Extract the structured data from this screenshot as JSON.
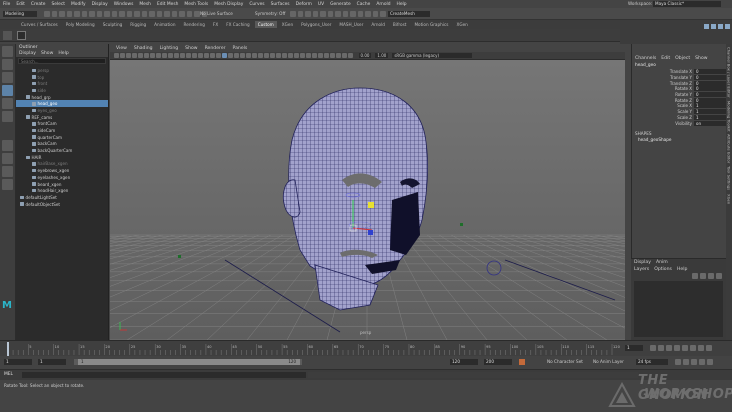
{
  "menubar": {
    "items": [
      "File",
      "Edit",
      "Create",
      "Select",
      "Modify",
      "Display",
      "Windows",
      "Mesh",
      "Edit Mesh",
      "Mesh Tools",
      "Mesh Display",
      "Curves",
      "Surfaces",
      "Deform",
      "UV",
      "Generate",
      "Cache",
      "Arnold",
      "Help"
    ],
    "workspace_label": "Workspace:",
    "workspace_value": "Maya Classic*"
  },
  "statusline": {
    "mode": "Modeling",
    "live_surface": "No Live Surface",
    "symmetry": "Symmetry: Off",
    "workspace_field": "CreateMesh"
  },
  "shelf": {
    "tabs": [
      "Curves / Surfaces",
      "Poly Modeling",
      "Sculpting",
      "Rigging",
      "Animation",
      "Rendering",
      "FX",
      "FX Caching",
      "Custom",
      "XGen",
      "Polygons_User",
      "MASH_User",
      "Arnold",
      "Bifrost",
      "Motion Graphics",
      "XGen"
    ],
    "active_tab": 8
  },
  "outliner": {
    "title": "Outliner",
    "menu": [
      "Display",
      "Show",
      "Help"
    ],
    "search_placeholder": "Search...",
    "items": [
      {
        "label": "persp",
        "indent": 2,
        "dim": true
      },
      {
        "label": "top",
        "indent": 2,
        "dim": true
      },
      {
        "label": "front",
        "indent": 2,
        "dim": true
      },
      {
        "label": "side",
        "indent": 2,
        "dim": true
      },
      {
        "label": "head_grp",
        "indent": 1,
        "dim": false
      },
      {
        "label": "head_geo",
        "indent": 2,
        "dim": false,
        "selected": true
      },
      {
        "label": "eyes_geo",
        "indent": 2,
        "dim": true
      },
      {
        "label": "REF_cams",
        "indent": 1,
        "dim": false
      },
      {
        "label": "frontCam",
        "indent": 2,
        "dim": false
      },
      {
        "label": "sideCam",
        "indent": 2,
        "dim": false
      },
      {
        "label": "quarterCam",
        "indent": 2,
        "dim": false
      },
      {
        "label": "backCam",
        "indent": 2,
        "dim": false
      },
      {
        "label": "backQuarterCam",
        "indent": 2,
        "dim": false
      },
      {
        "label": "HAIR",
        "indent": 1,
        "dim": false
      },
      {
        "label": "hairBase_xgen",
        "indent": 2,
        "dim": true
      },
      {
        "label": "eyebrows_xgen",
        "indent": 2,
        "dim": false
      },
      {
        "label": "eyelashes_xgen",
        "indent": 2,
        "dim": false
      },
      {
        "label": "beard_xgen",
        "indent": 2,
        "dim": false
      },
      {
        "label": "headHair_xgen",
        "indent": 2,
        "dim": false
      },
      {
        "label": "defaultLightSet",
        "indent": 0,
        "dim": false
      },
      {
        "label": "defaultObjectSet",
        "indent": 0,
        "dim": false
      }
    ]
  },
  "viewport": {
    "menu": [
      "View",
      "Shading",
      "Lighting",
      "Show",
      "Renderer",
      "Panels"
    ],
    "field_a": "0.00",
    "field_b": "1.00",
    "color_space": "sRGB gamma (legacy)",
    "camera_label": "persp"
  },
  "channelbox": {
    "tabs": [
      "Channels",
      "Edit",
      "Object",
      "Show"
    ],
    "object_name": "head_geo",
    "channels": [
      {
        "label": "Translate X",
        "value": "0"
      },
      {
        "label": "Translate Y",
        "value": "0"
      },
      {
        "label": "Translate Z",
        "value": "0"
      },
      {
        "label": "Rotate X",
        "value": "0"
      },
      {
        "label": "Rotate Y",
        "value": "0"
      },
      {
        "label": "Rotate Z",
        "value": "0"
      },
      {
        "label": "Scale X",
        "value": "1"
      },
      {
        "label": "Scale Y",
        "value": "1"
      },
      {
        "label": "Scale Z",
        "value": "1"
      },
      {
        "label": "Visibility",
        "value": "on"
      }
    ],
    "shapes_title": "SHAPES",
    "shape_name": "head_geoShape"
  },
  "side_tabs": [
    "Channel Box / Layer Editor",
    "Modeling Toolkit",
    "Attribute Editor",
    "Tool Settings",
    "XGen"
  ],
  "layer_editor": {
    "tabs": [
      "Display",
      "Anim"
    ],
    "menu": [
      "Layers",
      "Options",
      "Help"
    ]
  },
  "timeline": {
    "ticks": [
      "5",
      "10",
      "15",
      "20",
      "25",
      "30",
      "35",
      "40",
      "45",
      "50",
      "55",
      "60",
      "65",
      "70",
      "75",
      "80",
      "85",
      "90",
      "95",
      "100",
      "105",
      "110",
      "115",
      "120"
    ],
    "current_frame": "1"
  },
  "range": {
    "start": "1",
    "inner_start": "1",
    "inner_end": "120",
    "range_end": "120",
    "end": "200",
    "character_set": "No Character Set",
    "anim_layer": "No Anim Layer",
    "fps": "24 fps"
  },
  "cmdline": {
    "label": "MEL"
  },
  "helpline": {
    "text": "Rotate Tool: Select an object to rotate."
  },
  "watermark": {
    "line1": "THE GNOMON",
    "line2": "WORKSHOP"
  },
  "colors": {
    "selection": "#5283b3",
    "mesh_wire": "#22225a",
    "mesh_fill": "#9a9ac4",
    "viewport_bg": "#6f6f6f"
  }
}
